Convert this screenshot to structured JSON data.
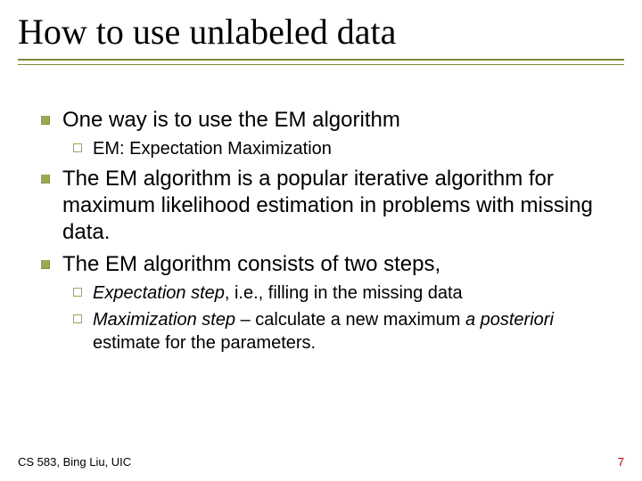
{
  "title": "How to use unlabeled data",
  "bullets": {
    "b1": "One way is to use the EM algorithm",
    "b1a": "EM: Expectation Maximization",
    "b2": "The EM algorithm is a popular iterative algorithm for maximum likelihood estimation in problems with missing data.",
    "b3": "The EM algorithm consists of two steps,",
    "b3a_em": "Expectation step",
    "b3a_rest": ", i.e., filling in the missing data",
    "b3b_em": "Maximization step",
    "b3b_mid": " – calculate a new maximum ",
    "b3b_em2": "a posteriori",
    "b3b_rest": " estimate for the parameters."
  },
  "footer": {
    "left": "CS 583, Bing Liu, UIC",
    "page": "7"
  }
}
